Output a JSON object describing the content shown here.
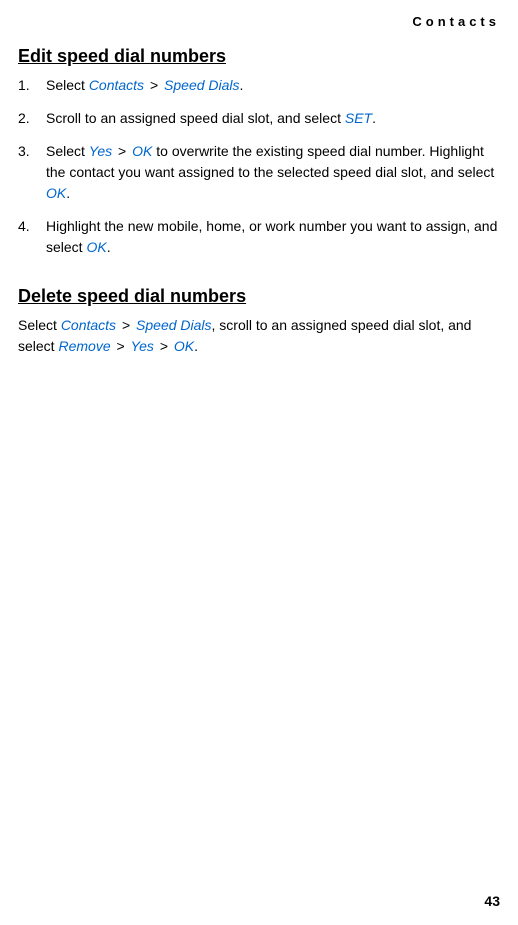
{
  "header": {
    "section_label": "Contacts"
  },
  "sections": {
    "edit": {
      "heading": "Edit speed dial numbers",
      "steps": {
        "s1": {
          "prefix": "Select ",
          "term1": "Contacts",
          "sep1": " > ",
          "term2": "Speed Dials",
          "suffix": "."
        },
        "s2": {
          "prefix": "Scroll to an assigned speed dial slot, and select ",
          "term1": "SET",
          "suffix": "."
        },
        "s3": {
          "prefix": "Select ",
          "term1": "Yes",
          "sep1": " > ",
          "term2": "OK",
          "mid1": " to overwrite the existing speed dial number. Highlight the contact you want assigned to the selected speed dial slot, and select ",
          "term3": "OK",
          "suffix": "."
        },
        "s4": {
          "prefix": "Highlight the new mobile, home, or work number you want to assign, and select ",
          "term1": "OK",
          "suffix": "."
        }
      }
    },
    "delete": {
      "heading": "Delete speed dial numbers",
      "para": {
        "prefix": "Select ",
        "term1": "Contacts",
        "sep1": " > ",
        "term2": "Speed Dials",
        "mid1": ", scroll to an assigned speed dial slot, and select ",
        "term3": "Remove",
        "sep2": " > ",
        "term4": "Yes",
        "sep3": " > ",
        "term5": "OK",
        "suffix": "."
      }
    }
  },
  "footer": {
    "page_number": "43"
  }
}
